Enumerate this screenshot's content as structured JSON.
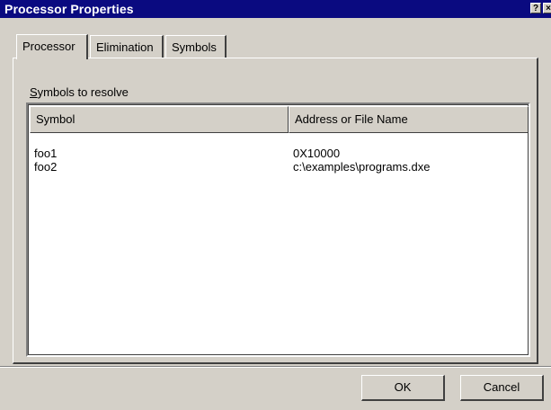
{
  "window": {
    "title": "Processor Properties",
    "help_glyph": "?",
    "close_glyph": "×"
  },
  "tabs": [
    {
      "label": "Processor",
      "active": true
    },
    {
      "label": "Elimination",
      "active": false
    },
    {
      "label": "Symbols",
      "active": false
    }
  ],
  "group": {
    "label_accel": "S",
    "label_rest": "ymbols to resolve"
  },
  "table": {
    "columns": [
      "Symbol",
      "Address or File Name"
    ],
    "rows": [
      {
        "symbol": "foo1",
        "address": "0X10000"
      },
      {
        "symbol": "foo2",
        "address": "c:\\examples\\programs.dxe"
      }
    ]
  },
  "buttons": {
    "ok": "OK",
    "cancel": "Cancel"
  },
  "colors": {
    "titlebar": "#0a0a80",
    "face": "#d4d0c8"
  }
}
